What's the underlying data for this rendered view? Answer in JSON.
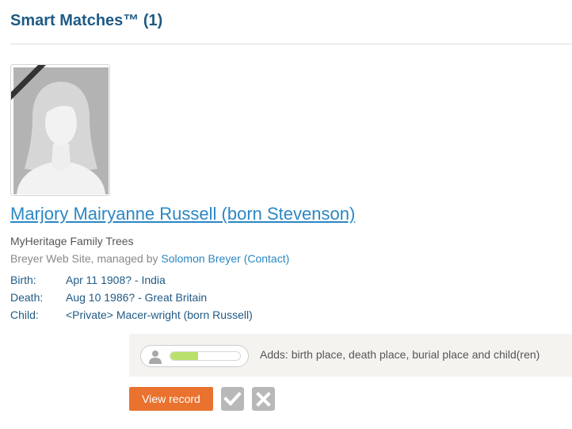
{
  "section": {
    "title": "Smart Matches™ (1)"
  },
  "match": {
    "photo_icon": "female-silhouette-icon",
    "deceased_ribbon_icon": "deceased-ribbon-icon",
    "name": "Marjory Mairyanne Russell (born Stevenson)",
    "source_name": "MyHeritage Family Trees",
    "site_prefix": "Breyer Web Site, managed by ",
    "manager_name": "Solomon Breyer",
    "contact_label": "(Contact)",
    "facts": [
      {
        "label": "Birth:",
        "value": "Apr 11 1908? - India"
      },
      {
        "label": "Death:",
        "value": "Aug 10 1986? - Great Britain"
      },
      {
        "label": "Child:",
        "value": "<Private> Macer-wright (born Russell)"
      }
    ]
  },
  "adds": {
    "person_icon": "person-icon",
    "quality_level": 0.4,
    "text": "Adds: birth place, death place, burial place and child(ren)"
  },
  "actions": {
    "view_label": "View record",
    "confirm_icon": "check-icon",
    "reject_icon": "x-icon"
  },
  "colors": {
    "title": "#1f5a85",
    "link": "#2b87c4",
    "view_button": "#e9722e",
    "quality_fill": "#b9e06a",
    "icon_button": "#b8b8b8"
  }
}
